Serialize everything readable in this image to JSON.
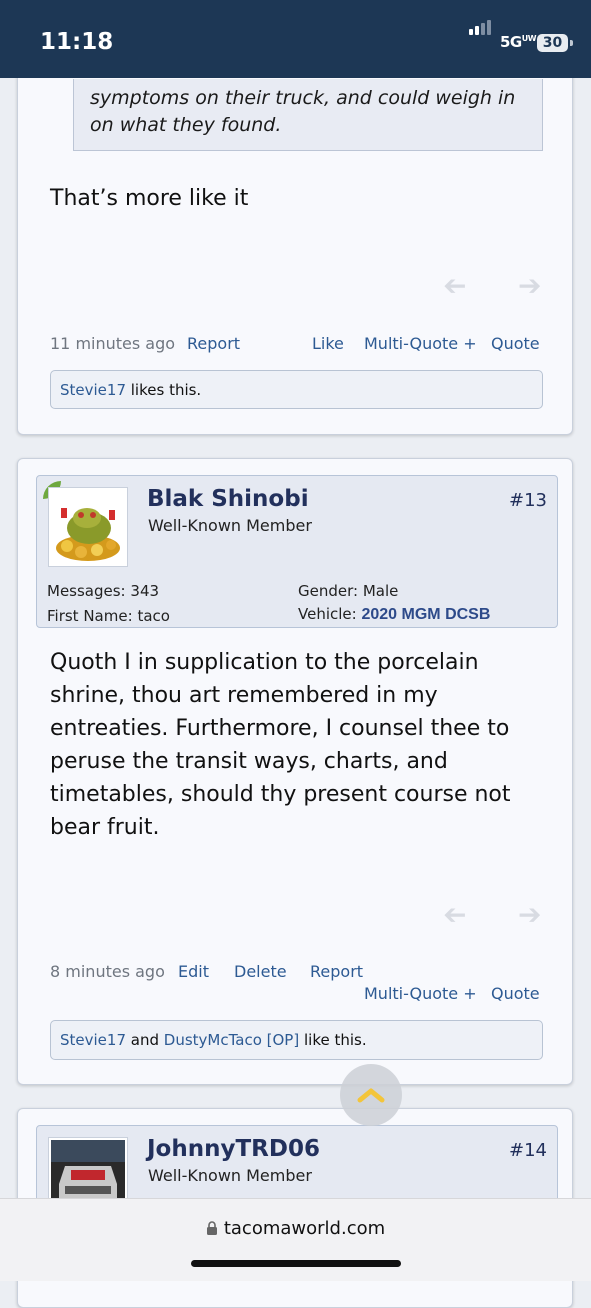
{
  "status_bar": {
    "time": "11:18",
    "network": "5G",
    "network_sup": "UW",
    "battery": "30"
  },
  "post12": {
    "quote_lines": [
      "symptoms on their truck, and could weigh in",
      "on what they found."
    ],
    "message": "That’s more like it",
    "time": "11 minutes ago",
    "report": "Report",
    "like": "Like",
    "multiquote": "Multi-Quote +",
    "quote": "Quote",
    "likes": {
      "user": "Stevie17",
      "suffix": " likes this."
    }
  },
  "post13": {
    "username": "Blak Shinobi",
    "user_title": "Well-Known Member",
    "post_number": "#13",
    "messages_label": "Messages:",
    "messages_value": "343",
    "firstname_label": "First Name:",
    "firstname_value": "taco",
    "gender_label": "Gender:",
    "gender_value": "Male",
    "vehicle_label": "Vehicle:",
    "vehicle_value": "2020 MGM DCSB",
    "message": "Quoth I in supplication to the porcelain shrine, thou art remembered in my entreaties. Furthermore, I counsel thee to peruse the transit ways, charts, and timetables, should thy present course not bear fruit.",
    "time": "8 minutes ago",
    "edit": "Edit",
    "delete": "Delete",
    "report": "Report",
    "multiquote": "Multi-Quote +",
    "quote": "Quote",
    "likes": {
      "user1": "Stevie17",
      "and": " and ",
      "user2": "DustyMcTaco [OP]",
      "suffix": " like this."
    }
  },
  "post14": {
    "username": "JohnnyTRD06",
    "user_title": "Well-Known Member",
    "post_number": "#14"
  },
  "browser": {
    "url": "tacomaworld.com"
  },
  "colors": {
    "header": "#1d3755",
    "link": "#2d5a93",
    "username": "#22305c",
    "online": "#6ea83f"
  }
}
